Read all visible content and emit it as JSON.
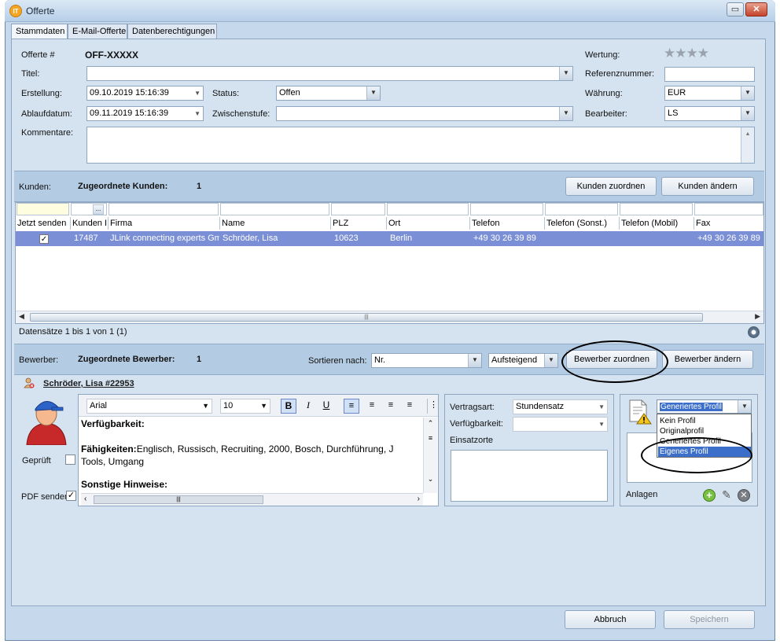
{
  "window": {
    "title": "Offerte",
    "app_icon": "IT",
    "minimize_label": "▭",
    "close_label": "✕"
  },
  "tabs": [
    {
      "label": "Stammdaten"
    },
    {
      "label": "E-Mail-Offerte"
    },
    {
      "label": "Datenberechtigungen"
    }
  ],
  "offer": {
    "offerte_label": "Offerte #",
    "offerte_value": "OFF-XXXXX",
    "titel_label": "Titel:",
    "titel_value": "",
    "erstellung_label": "Erstellung:",
    "erstellung_value": "09.10.2019 15:16:39",
    "ablauf_label": "Ablaufdatum:",
    "ablauf_value": "09.11.2019 15:16:39",
    "status_label": "Status:",
    "status_value": "Offen",
    "zwischen_label": "Zwischenstufe:",
    "zwischen_value": "",
    "kommentare_label": "Kommentare:",
    "wertung_label": "Wertung:",
    "wertung_stars": "★★★★",
    "referenz_label": "Referenznummer:",
    "referenz_value": "",
    "waehrung_label": "Währung:",
    "waehrung_value": "EUR",
    "bearbeiter_label": "Bearbeiter:",
    "bearbeiter_value": "LS"
  },
  "kunden": {
    "label": "Kunden:",
    "assigned_label": "Zugeordnete Kunden:",
    "assigned_count": "1",
    "assign_button": "Kunden zuordnen",
    "change_button": "Kunden ändern",
    "filter_button": "...",
    "columns": [
      "Jetzt senden",
      "Kunden I",
      "Firma",
      "Name",
      "PLZ",
      "Ort",
      "Telefon",
      "Telefon (Sonst.)",
      "Telefon (Mobil)",
      "Fax"
    ],
    "row": {
      "checked": "✓",
      "id": "17487",
      "firma": "JLink connecting experts Gm",
      "name": "Schröder, Lisa",
      "plz": "10623",
      "ort": "Berlin",
      "telefon": "+49 30 26 39 89",
      "tel_sonst": "",
      "tel_mobil": "",
      "fax": "+49 30 26 39 89"
    },
    "records": "Datensätze 1 bis 1 von 1 (1)"
  },
  "bewerber": {
    "label": "Bewerber:",
    "assigned_label": "Zugeordnete Bewerber:",
    "assigned_count": "1",
    "sort_label": "Sortieren nach:",
    "sort_value": "Nr.",
    "order_value": "Aufsteigend",
    "assign_button": "Bewerber zuordnen",
    "change_button": "Bewerber ändern",
    "name_link": "Schröder, Lisa #22953",
    "geprueft_label": "Geprüft",
    "pdf_label": "PDF senden",
    "pdf_checked": "✓",
    "font_name": "Arial",
    "font_size": "10",
    "bold_btn": "B",
    "italic_btn": "I",
    "underline_btn": "U",
    "rt_heading1": "Verfügbarkeit:",
    "rt_skills_label": "Fähigkeiten:",
    "rt_skills_text": "Englisch, Russisch, Recruiting, 2000, Bosch, Durchführung, J",
    "rt_skills_text2": "Tools, Umgang",
    "rt_heading2": "Sonstige Hinweise:",
    "vertragsart_label": "Vertragsart:",
    "vertragsart_value": "Stundensatz",
    "verfuegbarkeit_label": "Verfügbarkeit:",
    "verfuegbarkeit_value": "",
    "einsatzorte_label": "Einsatzorte",
    "profil_selected": "Generiertes Profil",
    "profil_options": [
      "Kein Profil",
      "Originalprofil",
      "Generiertes Profil",
      "Eigenes Profil"
    ],
    "anlagen_label": "Anlagen"
  },
  "footer": {
    "cancel_button": "Abbruch",
    "save_button": "Speichern"
  }
}
